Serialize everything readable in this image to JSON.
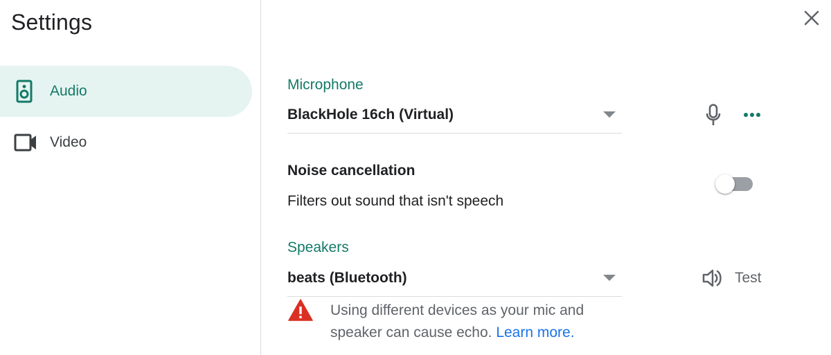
{
  "sidebar": {
    "title": "Settings",
    "items": [
      {
        "label": "Audio",
        "icon": "speaker-icon",
        "active": true
      },
      {
        "label": "Video",
        "icon": "video-camera-icon",
        "active": false
      }
    ]
  },
  "dialog": {
    "close_icon": "close-icon"
  },
  "audio": {
    "microphone": {
      "label": "Microphone",
      "selected": "BlackHole 16ch (Virtual)",
      "mic_icon": "microphone-icon",
      "more_icon": "more-options-icon"
    },
    "noise_cancellation": {
      "title": "Noise cancellation",
      "description": "Filters out sound that isn't speech",
      "enabled": false
    },
    "speakers": {
      "label": "Speakers",
      "selected": "beats (Bluetooth)",
      "test_label": "Test",
      "volume_icon": "volume-icon"
    },
    "warning": {
      "icon": "warning-icon",
      "text": "Using different devices as your mic and speaker can cause echo.",
      "link": "Learn more."
    }
  },
  "colors": {
    "accent": "#137a67",
    "active_bg": "#e6f4f1",
    "link": "#1a73e8",
    "warning": "#d93025",
    "toggle_track": "#9aa0a6"
  }
}
